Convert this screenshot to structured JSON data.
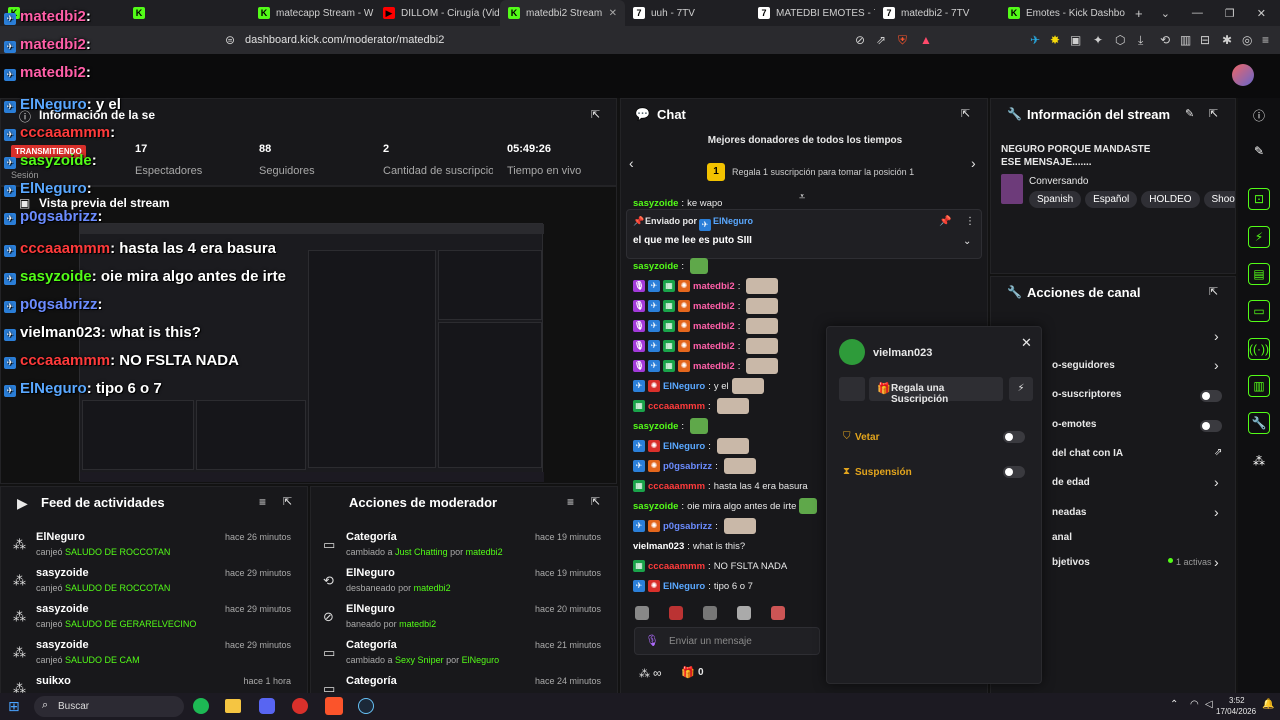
{
  "browser": {
    "tabs": [
      {
        "label": "",
        "icon": "kick-icon"
      },
      {
        "label": "",
        "icon": "kick-icon"
      },
      {
        "label": "matecapp Stream - W",
        "icon": "kick-icon"
      },
      {
        "label": "DILLOM - Cirugía (Video",
        "icon": "youtube-icon"
      },
      {
        "label": "matedbi2 Stream",
        "icon": "kick-icon"
      },
      {
        "label": "uuh - 7TV",
        "icon": "7tv-icon"
      },
      {
        "label": "MATEDBI EMOTES - 7TV",
        "icon": "7tv-icon"
      },
      {
        "label": "matedbi2 - 7TV",
        "icon": "7tv-icon"
      },
      {
        "label": "Emotes - Kick Dashboard",
        "icon": "kick-icon"
      }
    ],
    "url": "dashboard.kick.com/moderator/matedbi2"
  },
  "stream_info": {
    "title": "Información de la se",
    "live_badge": "TRANSMITIENDO",
    "session_label": "Sesión",
    "stats": [
      {
        "value": "17",
        "label": "Espectadores"
      },
      {
        "value": "88",
        "label": "Seguidores"
      },
      {
        "value": "2",
        "label": "Cantidad de suscripciones"
      },
      {
        "value": "05:49:26",
        "label": "Tiempo en vivo"
      }
    ],
    "preview_title": "Vista previa del stream"
  },
  "activity_feed": {
    "title": "Feed de actividades",
    "items": [
      {
        "name": "ElNeguro",
        "action": "canjeó",
        "reward": "SALUDO DE ROCCOTAN",
        "time": "hace 26 minutos"
      },
      {
        "name": "sasyzoide",
        "action": "canjeó",
        "reward": "SALUDO DE ROCCOTAN",
        "time": "hace 29 minutos"
      },
      {
        "name": "sasyzoide",
        "action": "canjeó",
        "reward": "SALUDO DE GERARELVECINO",
        "time": "hace 29 minutos"
      },
      {
        "name": "sasyzoide",
        "action": "canjeó",
        "reward": "SALUDO DE CAM",
        "time": "hace 29 minutos"
      },
      {
        "name": "suikxo",
        "action": "",
        "reward": "",
        "time": "hace 1 hora"
      }
    ]
  },
  "mod_actions": {
    "title": "Acciones de moderador",
    "items": [
      {
        "title": "Categoría",
        "pre": "cambiado a",
        "target": "Just Chatting",
        "mid": "por",
        "by": "matedbi2",
        "time": "hace 19 minutos",
        "icon": "category-icon"
      },
      {
        "title": "ElNeguro",
        "pre": "desbaneado",
        "target": "",
        "mid": "por",
        "by": "matedbi2",
        "time": "hace 19 minutos",
        "icon": "unban-icon"
      },
      {
        "title": "ElNeguro",
        "pre": "baneado",
        "target": "",
        "mid": "por",
        "by": "matedbi2",
        "time": "hace 20 minutos",
        "icon": "ban-icon"
      },
      {
        "title": "Categoría",
        "pre": "cambiado a",
        "target": "Sexy Sniper",
        "mid": "por",
        "by": "ElNeguro",
        "time": "hace 21 minutos",
        "icon": "category-icon"
      },
      {
        "title": "Categoría",
        "pre": "",
        "target": "",
        "mid": "",
        "by": "",
        "time": "hace 24 minutos",
        "icon": "category-icon"
      }
    ]
  },
  "chat": {
    "title": "Chat",
    "top_donors": "Mejores donadores de todos los tiempos",
    "rank": "1",
    "gift_prompt": "Regala 1 suscripción para tomar la posición 1",
    "pinned_by_label": "Enviado por",
    "pinned_by": "ElNeguro",
    "pinned_msg": "el que me lee es puto SIII",
    "lines": [
      {
        "user": "sasyzoide",
        "color": "#53fc18",
        "text": "ke wapo",
        "badges": []
      },
      {
        "user": "sasyzoide",
        "color": "#53fc18",
        "text": "",
        "badges": [],
        "emote": true
      },
      {
        "user": "matedbi2",
        "color": "#ff5fa8",
        "text": "",
        "badges": [
          "b-pur",
          "b-blue",
          "b-grn",
          "b-org"
        ],
        "emote": true
      },
      {
        "user": "matedbi2",
        "color": "#ff5fa8",
        "text": "",
        "badges": [
          "b-pur",
          "b-blue",
          "b-grn",
          "b-org"
        ],
        "emote": true
      },
      {
        "user": "matedbi2",
        "color": "#ff5fa8",
        "text": "",
        "badges": [
          "b-pur",
          "b-blue",
          "b-grn",
          "b-org"
        ],
        "emote": true
      },
      {
        "user": "matedbi2",
        "color": "#ff5fa8",
        "text": "",
        "badges": [
          "b-pur",
          "b-blue",
          "b-grn",
          "b-org"
        ],
        "emote": true
      },
      {
        "user": "matedbi2",
        "color": "#ff5fa8",
        "text": "",
        "badges": [
          "b-pur",
          "b-blue",
          "b-grn",
          "b-org"
        ],
        "emote": true
      },
      {
        "user": "ElNeguro",
        "color": "#5aa8ff",
        "text": "y el",
        "badges": [
          "b-blue",
          "b-red"
        ],
        "emote": true
      },
      {
        "user": "cccaaammm",
        "color": "#ff3b3b",
        "text": "",
        "badges": [
          "b-grn"
        ],
        "emote": true
      },
      {
        "user": "sasyzoide",
        "color": "#53fc18",
        "text": "",
        "badges": [],
        "emote": true
      },
      {
        "user": "ElNeguro",
        "color": "#5aa8ff",
        "text": "",
        "badges": [
          "b-blue",
          "b-red"
        ],
        "emote": true
      },
      {
        "user": "p0gsabrizz",
        "color": "#6b8cff",
        "text": "",
        "badges": [
          "b-blue",
          "b-org"
        ],
        "emote": true
      },
      {
        "user": "cccaaammm",
        "color": "#ff3b3b",
        "text": "hasta las 4 era basura",
        "badges": [
          "b-grn"
        ]
      },
      {
        "user": "sasyzoide",
        "color": "#53fc18",
        "text": "oie mira algo antes de irte",
        "badges": [],
        "emote": true
      },
      {
        "user": "p0gsabrizz",
        "color": "#6b8cff",
        "text": "",
        "badges": [
          "b-blue",
          "b-org"
        ],
        "emote": true
      },
      {
        "user": "vielman023",
        "color": "#ffffff",
        "text": "what is this?",
        "badges": []
      },
      {
        "user": "cccaaammm",
        "color": "#ff3b3b",
        "text": "NO FSLTA NADA",
        "badges": [
          "b-grn"
        ]
      },
      {
        "user": "ElNeguro",
        "color": "#5aa8ff",
        "text": "tipo 6 o 7",
        "badges": [
          "b-blue",
          "b-red"
        ]
      }
    ],
    "input_placeholder": "Enviar un mensaje",
    "infinity_label": "∞",
    "gift_count": "0"
  },
  "user_card": {
    "username": "vielman023",
    "gift_button": "Regala una Suscripción",
    "options": [
      {
        "label": "Vetar",
        "color": "#e3a51d"
      },
      {
        "label": "Suspensión",
        "color": "#e3a51d"
      }
    ]
  },
  "stream_details": {
    "title": "Información del stream",
    "stream_title": "NEGURO PORQUE MANDASTE ESE MENSAJE.......",
    "category": "Conversando",
    "tags": [
      "Spanish",
      "Español",
      "HOLDEO",
      "Shooter"
    ]
  },
  "channel_actions": {
    "title": "Acciones de canal",
    "items": [
      {
        "label": "",
        "control": "arrow"
      },
      {
        "label": "o-seguidores",
        "control": "arrow"
      },
      {
        "label": "o-suscriptores",
        "control": "toggle"
      },
      {
        "label": "o-emotes",
        "control": "toggle"
      },
      {
        "label": "del chat con IA",
        "control": "external"
      },
      {
        "label": "de edad",
        "control": "arrow"
      },
      {
        "label": "neadas",
        "control": "arrow"
      },
      {
        "label": "anal",
        "control": "none"
      },
      {
        "label": "bjetivos",
        "control": "arrow",
        "extra": "1 activas"
      }
    ]
  },
  "overlay_chat": [
    {
      "user": "matedbi2",
      "text": "",
      "color": "#ff5fa8"
    },
    {
      "user": "matedbi2",
      "text": "",
      "color": "#ff5fa8"
    },
    {
      "user": "matedbi2",
      "text": "",
      "color": "#ff5fa8"
    },
    {
      "user": "ElNeguro",
      "text": "y el",
      "color": "#5aa8ff"
    },
    {
      "user": "cccaaammm",
      "text": "",
      "color": "#ff3b3b"
    },
    {
      "user": "sasyzoide",
      "text": "",
      "color": "#53fc18"
    },
    {
      "user": "ElNeguro",
      "text": "",
      "color": "#5aa8ff"
    },
    {
      "user": "p0gsabrizz",
      "text": "",
      "color": "#6b8cff"
    },
    {
      "user": "cccaaammm",
      "text": "hasta las 4 era basura",
      "color": "#ff3b3b"
    },
    {
      "user": "sasyzoide",
      "text": "oie mira algo antes de irte",
      "color": "#53fc18"
    },
    {
      "user": "p0gsabrizz",
      "text": "",
      "color": "#6b8cff"
    },
    {
      "user": "vielman023",
      "text": "what is this?",
      "color": "#ffffff"
    },
    {
      "user": "cccaaammm",
      "text": "NO FSLTA NADA",
      "color": "#ff3b3b"
    },
    {
      "user": "ElNeguro",
      "text": "tipo 6 o 7",
      "color": "#5aa8ff"
    }
  ],
  "taskbar": {
    "search_placeholder": "Buscar",
    "time": "3:52",
    "date": "17/04/2026"
  }
}
